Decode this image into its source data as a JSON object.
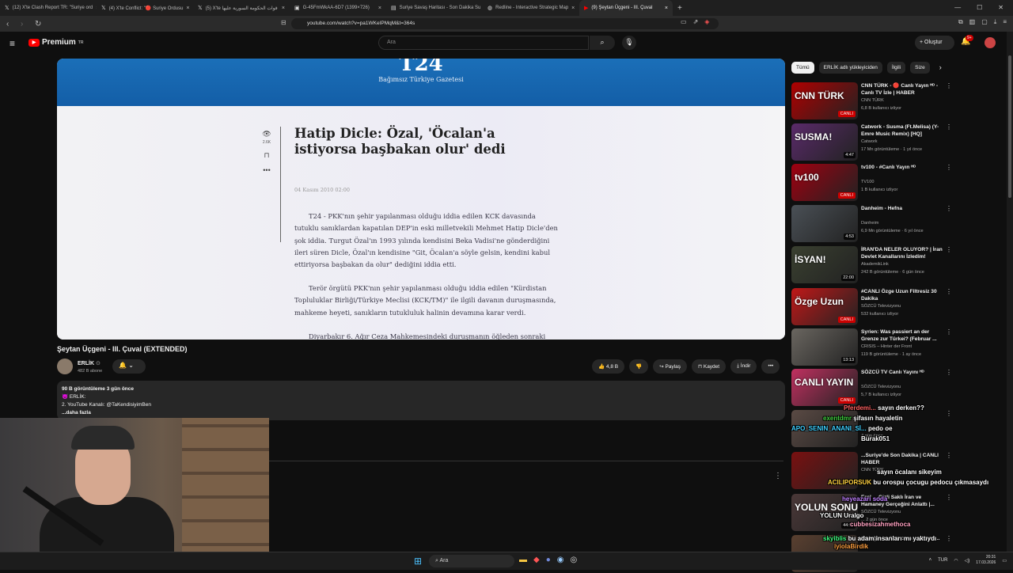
{
  "tabs": [
    {
      "label": "(12) X'te Clash Report TR: \"Suriye ord",
      "icon": "x-icon"
    },
    {
      "label": "(4) X'te Conflict: \"🔴 Suriye Ordusu",
      "icon": "x-icon"
    },
    {
      "label": "(5) X'te قوات الحكومة السورية عليها",
      "icon": "x-icon"
    },
    {
      "label": "G-45FmWkAA-6D7 (1399×726)",
      "icon": "image-icon"
    },
    {
      "label": "Suriye Savaş Haritası - Son Dakika Su",
      "icon": "map-icon"
    },
    {
      "label": "Redline - Interactive Strategic Map",
      "icon": "globe-icon"
    },
    {
      "label": "(9) Şeytan Üçgeni - III. Çuval",
      "icon": "youtube-icon",
      "active": true
    }
  ],
  "address": {
    "url": "youtube.com/watch?v=pa1WKeIPMqM&t=364s"
  },
  "youtube": {
    "logo_text": "Premium",
    "logo_sup": "TR",
    "search_placeholder": "Ara",
    "create_label": "Oluştur",
    "notif_count": "9+"
  },
  "video": {
    "site_logo": "T24",
    "site_tagline": "Bağımsız Türkiye Gazetesi",
    "view_count": "2.6K",
    "headline": "Hatip Dicle: Özal, 'Öcalan'a istiyorsa başbakan olur' dedi",
    "date": "04 Kasım 2010 02:00",
    "para1": "T24 - PKK'nın şehir yapılanması olduğu iddia edilen KCK davasında tutuklu sanıklardan kapatılan DEP'in eski milletvekili Mehmet Hatip Dicle'den şok iddia. Turgut Özal'ın 1993 yılında kendisini Beka Vadisi'ne gönderdiğini ileri süren Dicle, Özal'ın kendisine \"Git, Öcalan'a söyle gelsin, kendini kabul ettiriyorsa başbakan da olur\" dediğini iddia etti.",
    "para2": "Terör örgütü PKK'nın şehir yapılanması olduğu iddia edilen \"Kürdistan Topluluklar Birliği/Türkiye Meclisi (KCK/TM)\" ile ilgili davanın duruşmasında, mahkeme heyeti, sanıkların tutukluluk halinin devamına karar verdi.",
    "para3": "Diyarbakır 6. Ağır Ceza Mahkemesindeki duruşmanın öğleden sonraki"
  },
  "meta": {
    "title": "Şeytan Üçgeni - III. Çuval (EXTENDED)",
    "channel": "ERLİK",
    "verified": "⊙",
    "subscribers": "482 B abone",
    "likes": "4,8 B",
    "share": "Paylaş",
    "save": "Kaydet",
    "download": "İndir",
    "desc_stats": "90 B görüntüleme  3 gün önce",
    "desc_line1": "👿 ERLİK:",
    "desc_line2": "2. YouTube Kanalı:  @TaKendisiyimBen",
    "desc_more": "...daha fazla"
  },
  "chips": [
    "Tümü",
    "ERLİK adlı yükleyiciden",
    "İlgili",
    "Size"
  ],
  "recommendations": [
    {
      "title": "CNN TÜRK - 🔴 Canlı Yayın ᴴᴰ - Canlı TV İzle | HABER",
      "channel": "CNN TÜRK",
      "meta": "6,8 B kullanıcı izliyor",
      "badge": "CANLI",
      "thumb_text": "CNN TÜRK",
      "color": "#b00000"
    },
    {
      "title": "Catwork - Susma (Ft.Melisa) (Y-Emre Music Remix) [HQ]",
      "channel": "Catwork",
      "meta": "17 Mn görüntüleme · 1 yıl önce",
      "badge": "4:47",
      "thumb_text": "SUSMA!",
      "color": "#5a2a6a"
    },
    {
      "title": "tv100 - #Canlı Yayın ᴴᴰ",
      "channel": "TV100",
      "meta": "1 B kullanıcı izliyor",
      "badge": "CANLI",
      "thumb_text": "tv100",
      "color": "#a00010"
    },
    {
      "title": "Danheim - Hefna",
      "channel": "Danheim",
      "meta": "6,9 Mn görüntüleme · 6 yıl önce",
      "badge": "4:53",
      "thumb_text": "",
      "color": "#4a5056"
    },
    {
      "title": "İRAN'DA NELER OLUYOR? | İran Devlet Kanallarını İzledim!",
      "channel": "AkademikLink",
      "meta": "242 B görüntüleme · 6 gün önce",
      "badge": "22:00",
      "thumb_text": "İSYAN!",
      "color": "#3a4030"
    },
    {
      "title": "#CANLI Özge Uzun Filtresiz 30 Dakika",
      "channel": "SÖZCÜ Televizyonu",
      "meta": "532 kullanıcı izliyor",
      "badge": "CANLI",
      "thumb_text": "Özge Uzun",
      "color": "#c01818"
    },
    {
      "title": "Syrien: Was passiert an der Grenze zur Türkei? (Februar ...",
      "channel": "CRISIS – Hinter der Front",
      "meta": "119 B görüntüleme · 1 ay önce",
      "badge": "13:13",
      "thumb_text": "",
      "color": "#6a6660"
    },
    {
      "title": "SÖZCÜ TV Canlı Yayını ᴴᴰ",
      "channel": "SÖZCÜ Televizyonu",
      "meta": "5,7 B kullanıcı izliyor",
      "badge": "CANLI",
      "thumb_text": "CANLI YAYIN",
      "color": "#c03060"
    },
    {
      "title": "",
      "channel": "",
      "meta": "4 gün önce",
      "badge": "",
      "thumb_text": "",
      "color": "#5a4a44"
    },
    {
      "title": "...Suriye'de Son Dakika | CANLI HABER",
      "channel": "CNN TÜRK",
      "meta": "",
      "badge": "",
      "thumb_text": "",
      "color": "#7a1010"
    },
    {
      "title": "Erol ... Gizli Saklı İran ve Hamaney Gerçeğini Anlattı |...",
      "channel": "SÖZCÜ Televizyonu",
      "meta": "... 2 gün önce",
      "badge": "44:50",
      "thumb_text": "YOLUN SONU",
      "color": "#4a3838"
    },
    {
      "title": "Erdoğan'ın Doktorasını Veren ...",
      "channel": "",
      "meta": "",
      "badge": "",
      "thumb_text": "",
      "color": "#5a4030"
    }
  ],
  "chat": [
    {
      "name": "Pferdemi...",
      "text": "sayın derken??",
      "name_color": "#ff6060"
    },
    {
      "name": "exentdmr",
      "text": "şifasın hayaletin",
      "name_color": "#40d040"
    },
    {
      "name": "APO_SENIN_ANANI_Sİ...",
      "text": "pedo oe",
      "name_color": "#40d0ff"
    },
    {
      "name": "Burak051",
      "text": "",
      "name_color": "#ffffff"
    },
    {
      "name": "",
      "text": "sayın öcalanı sikeyim",
      "name_color": "#ffffff"
    },
    {
      "name": "ACILIPORSUK",
      "text": "bu orospu çocugu pedocu çıkmasaydı",
      "name_color": "#ffd040"
    },
    {
      "name": "heyeazarı soda",
      "text": "",
      "name_color": "#c080ff"
    },
    {
      "name": "YOLUN Uralgo",
      "text": "",
      "name_color": "#ffffff"
    },
    {
      "name": "cubbesizahmethoca",
      "text": "",
      "name_color": "#ffa0c0"
    },
    {
      "name": "skyiblis",
      "text": "bu adam insanları mı yaktıydı",
      "name_color": "#40ff80"
    },
    {
      "name": "iyiolaBirdik",
      "text": "",
      "name_color": "#ffa040"
    }
  ],
  "taskbar": {
    "search_placeholder": "Ara",
    "lang": "TUR",
    "time": "20:31",
    "date": "17.03.2026"
  }
}
